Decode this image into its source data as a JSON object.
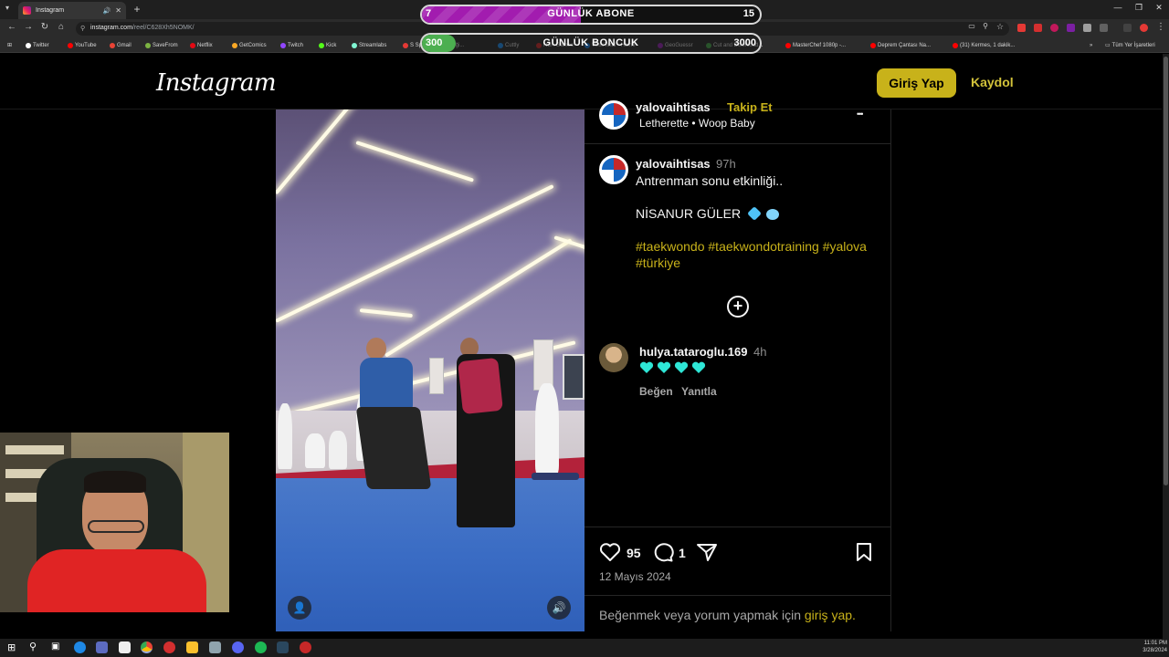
{
  "browser": {
    "tab_title": "Instagram",
    "new_tab": "+",
    "url_host": "instagram.com",
    "url_path": "/reel/C628Xh5NOMK/",
    "bookmarks": [
      {
        "label": "Twitter",
        "color": "#ffffff"
      },
      {
        "label": "YouTube",
        "color": "#ff0000"
      },
      {
        "label": "Gmail",
        "color": "#ea4335"
      },
      {
        "label": "SaveFrom",
        "color": "#7cb342"
      },
      {
        "label": "Netflix",
        "color": "#e50914"
      },
      {
        "label": "GetComics",
        "color": "#f9a825"
      },
      {
        "label": "Twitch",
        "color": "#9146ff"
      },
      {
        "label": "Kick",
        "color": "#53fc18"
      },
      {
        "label": "Streamlabs",
        "color": "#80f5d2"
      },
      {
        "label": "S Sport Plus-İstediği...",
        "color": "#e53935"
      },
      {
        "label": "Cuttly",
        "color": "#1e88e5"
      },
      {
        "label": "NBA Games",
        "color": "#c62828"
      },
      {
        "label": "VirusTotal - Home",
        "color": "#1976d2"
      },
      {
        "label": "GeoGuessr",
        "color": "#8e24aa"
      },
      {
        "label": "Cut and Download...",
        "color": "#43a047"
      },
      {
        "label": "MasterChef 1080p -...",
        "color": "#ff0000"
      },
      {
        "label": "Deprem Çantası Na...",
        "color": "#ff0000"
      },
      {
        "label": "(31) Kermes, 1 dakik...",
        "color": "#ff0000"
      }
    ],
    "other_bookmarks": "Tüm Yer İşaretleri"
  },
  "overlays": {
    "subs": {
      "left": "7",
      "title": "GÜNLÜK ABONE",
      "right": "15",
      "progress": 0.47,
      "color": "#a21caf"
    },
    "beads": {
      "left": "300",
      "title": "GÜNLÜK BONCUK",
      "right": "3000",
      "progress": 0.1,
      "color": "#4caf50"
    }
  },
  "instagram": {
    "logo": "Instagram",
    "login_button": "Giriş Yap",
    "signup_link": "Kaydol",
    "post": {
      "header_username": "yalovaihtisas",
      "header_follow": "Takip Et",
      "audio": "Letherette • Woop Baby",
      "more": "•••",
      "caption_username": "yalovaihtisas",
      "caption_time": "97h",
      "caption_line1": "Antrenman sonu etkinliği..",
      "caption_line2": "NİSANUR GÜLER",
      "hashtags_line1": "#taekwondo #taekwondotraining #yalova",
      "hashtags_line2": "#türkiye",
      "comment": {
        "username": "hulya.tataroglu.169",
        "time": "4h",
        "like": "Beğen",
        "reply": "Yanıtla"
      },
      "likes": "95",
      "comments": "1",
      "date": "12 Mayıs 2024",
      "login_prompt": "Beğenmek veya yorum yapmak için",
      "login_prompt_link": "giriş yap."
    }
  },
  "taskbar": {
    "time": "11:01 PM",
    "date": "3/28/2024"
  },
  "colors": {
    "accent": "#c8b21a",
    "background": "#000000"
  }
}
